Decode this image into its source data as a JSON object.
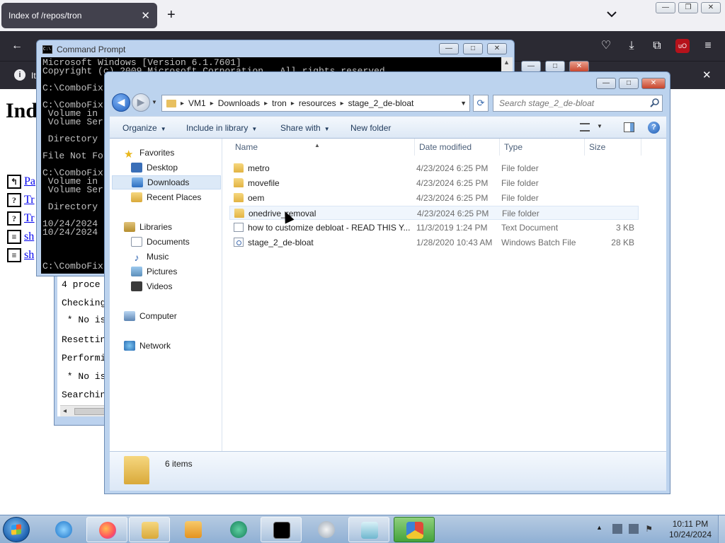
{
  "firefox": {
    "tab_title": "Index of /repos/tron",
    "tab_close": "✕",
    "new_tab": "+",
    "notification_text": "It"
  },
  "webpage": {
    "heading": "Ind",
    "links": [
      "Pa",
      "Tr",
      "Tr",
      "sh",
      "sh"
    ]
  },
  "cmd": {
    "title": "Command Prompt",
    "lines": [
      "Microsoft Windows [Version 6.1.7601]",
      "Copyright (c) 2009 Microsoft Corporation.  All rights reserved.",
      "",
      "C:\\ComboFix",
      "",
      "C:\\ComboFix",
      " Volume in",
      " Volume Ser",
      "",
      " Directory",
      "",
      "File Not Fo",
      "",
      "C:\\ComboFix",
      " Volume in",
      " Volume Ser",
      "",
      " Directory",
      "",
      "10/24/2024",
      "10/24/2024",
      "",
      "",
      "",
      "",
      "C:\\ComboFix"
    ]
  },
  "console_behind": {
    "lines": [
      "4 proce",
      "",
      "Checking",
      "",
      " * No is",
      "",
      "Resettin",
      "",
      "Performi",
      "",
      " * No is",
      "",
      "Searchin"
    ]
  },
  "explorer": {
    "breadcrumb": [
      "VM1",
      "Downloads",
      "tron",
      "resources",
      "stage_2_de-bloat"
    ],
    "search_placeholder": "Search stage_2_de-bloat",
    "commands": {
      "organize": "Organize",
      "include_in_library": "Include in library",
      "share_with": "Share with",
      "new_folder": "New folder"
    },
    "nav": {
      "favorites": "Favorites",
      "desktop": "Desktop",
      "downloads": "Downloads",
      "recent_places": "Recent Places",
      "libraries": "Libraries",
      "documents": "Documents",
      "music": "Music",
      "pictures": "Pictures",
      "videos": "Videos",
      "computer": "Computer",
      "network": "Network"
    },
    "columns": {
      "name": "Name",
      "date_modified": "Date modified",
      "type": "Type",
      "size": "Size"
    },
    "files": [
      {
        "name": "metro",
        "date": "4/23/2024 6:25 PM",
        "type": "File folder",
        "size": "",
        "icon": "folder-icon"
      },
      {
        "name": "movefile",
        "date": "4/23/2024 6:25 PM",
        "type": "File folder",
        "size": "",
        "icon": "folder-icon"
      },
      {
        "name": "oem",
        "date": "4/23/2024 6:25 PM",
        "type": "File folder",
        "size": "",
        "icon": "folder-icon"
      },
      {
        "name": "onedrive_removal",
        "date": "4/23/2024 6:25 PM",
        "type": "File folder",
        "size": "",
        "icon": "folder-icon"
      },
      {
        "name": "how to customize debloat - READ THIS Y...",
        "date": "11/3/2019 1:24 PM",
        "type": "Text Document",
        "size": "3 KB",
        "icon": "text-document-icon"
      },
      {
        "name": "stage_2_de-bloat",
        "date": "1/28/2020 10:43 AM",
        "type": "Windows Batch File",
        "size": "28 KB",
        "icon": "batch-file-icon"
      }
    ],
    "items_count": "6 items"
  },
  "taskbar": {
    "clock_time": "10:11 PM",
    "clock_date": "10/24/2024"
  }
}
